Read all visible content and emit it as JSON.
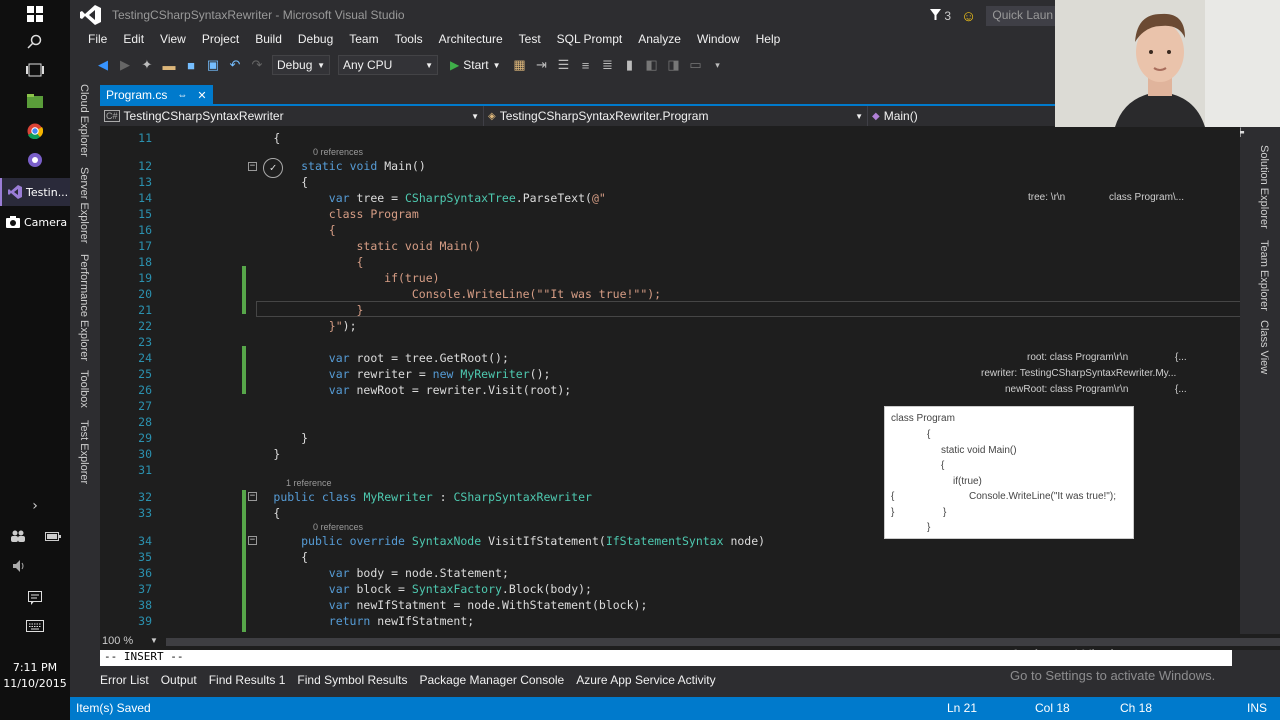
{
  "taskbar": {
    "apps": [
      {
        "label": "Testin...",
        "active": true
      },
      {
        "label": "Camera",
        "active": false
      }
    ],
    "clock_time": "7:11 PM",
    "clock_date": "11/10/2015"
  },
  "window": {
    "title": "TestingCSharpSyntaxRewriter - Microsoft Visual Studio",
    "notification_count": "3",
    "quick_launch_placeholder": "Quick Laun"
  },
  "menu": [
    "File",
    "Edit",
    "View",
    "Project",
    "Build",
    "Debug",
    "Team",
    "Tools",
    "Architecture",
    "Test",
    "SQL Prompt",
    "Analyze",
    "Window",
    "Help"
  ],
  "toolbar": {
    "config": "Debug",
    "platform": "Any CPU",
    "start_label": "Start"
  },
  "left_tool_tabs": [
    "Cloud Explorer",
    "Server Explorer",
    "Performance Explorer",
    "Toolbox",
    "Test Explorer"
  ],
  "right_tool_tabs": [
    "Solution Explorer",
    "Team Explorer",
    "Class View"
  ],
  "document_tab": {
    "label": "Program.cs",
    "pin": "⇔",
    "close": "✕"
  },
  "navbar": {
    "project": "TestingCSharpSyntaxRewriter",
    "type": "TestingCSharpSyntaxRewriter.Program",
    "member": "Main()"
  },
  "code_lines": [
    {
      "n": "11",
      "text": "        {"
    },
    {
      "n": "12",
      "text": "            static void Main()",
      "lens": "0 references"
    },
    {
      "n": "13",
      "text": "            {"
    },
    {
      "n": "14",
      "text": "                var tree = CSharpSyntaxTree.ParseText(@\""
    },
    {
      "n": "15",
      "text": "                class Program"
    },
    {
      "n": "16",
      "text": "                {"
    },
    {
      "n": "17",
      "text": "                    static void Main()"
    },
    {
      "n": "18",
      "text": "                    {"
    },
    {
      "n": "19",
      "text": "                        if(true)"
    },
    {
      "n": "20",
      "text": "                            Console.WriteLine(\"\"It was true!\"\");"
    },
    {
      "n": "21",
      "text": "                    }"
    },
    {
      "n": "22",
      "text": "                }\");"
    },
    {
      "n": "23",
      "text": ""
    },
    {
      "n": "24",
      "text": "                var root = tree.GetRoot();"
    },
    {
      "n": "25",
      "text": "                var rewriter = new MyRewriter();"
    },
    {
      "n": "26",
      "text": "                var newRoot = rewriter.Visit(root);"
    },
    {
      "n": "27",
      "text": ""
    },
    {
      "n": "28",
      "text": ""
    },
    {
      "n": "29",
      "text": "            }"
    },
    {
      "n": "30",
      "text": "        }"
    },
    {
      "n": "31",
      "text": ""
    },
    {
      "n": "32",
      "text": "        public class MyRewriter : CSharpSyntaxRewriter",
      "lens": "1 reference"
    },
    {
      "n": "33",
      "text": "        {"
    },
    {
      "n": "34",
      "text": "            public override SyntaxNode VisitIfStatement(IfStatementSyntax node)",
      "lens": "0 references"
    },
    {
      "n": "35",
      "text": "            {"
    },
    {
      "n": "36",
      "text": "                var body = node.Statement;"
    },
    {
      "n": "37",
      "text": "                var block = SyntaxFactory.Block(body);"
    },
    {
      "n": "38",
      "text": "                var newIfStatment = node.WithStatement(block);"
    },
    {
      "n": "39",
      "text": "                return newIfStatment;"
    }
  ],
  "datatips": {
    "tree_name": "tree: \\r\\n",
    "tree_value": "class Program\\...",
    "root_name": "root: class Program\\r\\n",
    "root_value": "{...",
    "rewriter": "rewriter: TestingCSharpSyntaxRewriter.My...",
    "newroot_name": "newRoot: class Program\\r\\n",
    "newroot_value": "{..."
  },
  "visualizer_popup": {
    "lines": [
      "class Program",
      "{",
      "static void Main()",
      "{",
      "if(true)",
      "Console.WriteLine(\"It was true!\");",
      "{",
      "}",
      "}",
      "}"
    ]
  },
  "editor": {
    "zoom": "100 %",
    "mode_line": "-- INSERT --"
  },
  "bottom_tabs": [
    "Error List",
    "Output",
    "Find Results 1",
    "Find Symbol Results",
    "Package Manager Console",
    "Azure App Service Activity"
  ],
  "watermark": {
    "title": "Activate Windows",
    "subtitle": "Go to Settings to activate Windows."
  },
  "status": {
    "message": "Item(s) Saved",
    "ln": "Ln 21",
    "col": "Col 18",
    "ch": "Ch 18",
    "ins": "INS"
  },
  "colors": {
    "accent": "#007acc",
    "keyword": "#569cd6",
    "type": "#4ec9b0",
    "string": "#d69d85",
    "line_number": "#2b91af"
  }
}
